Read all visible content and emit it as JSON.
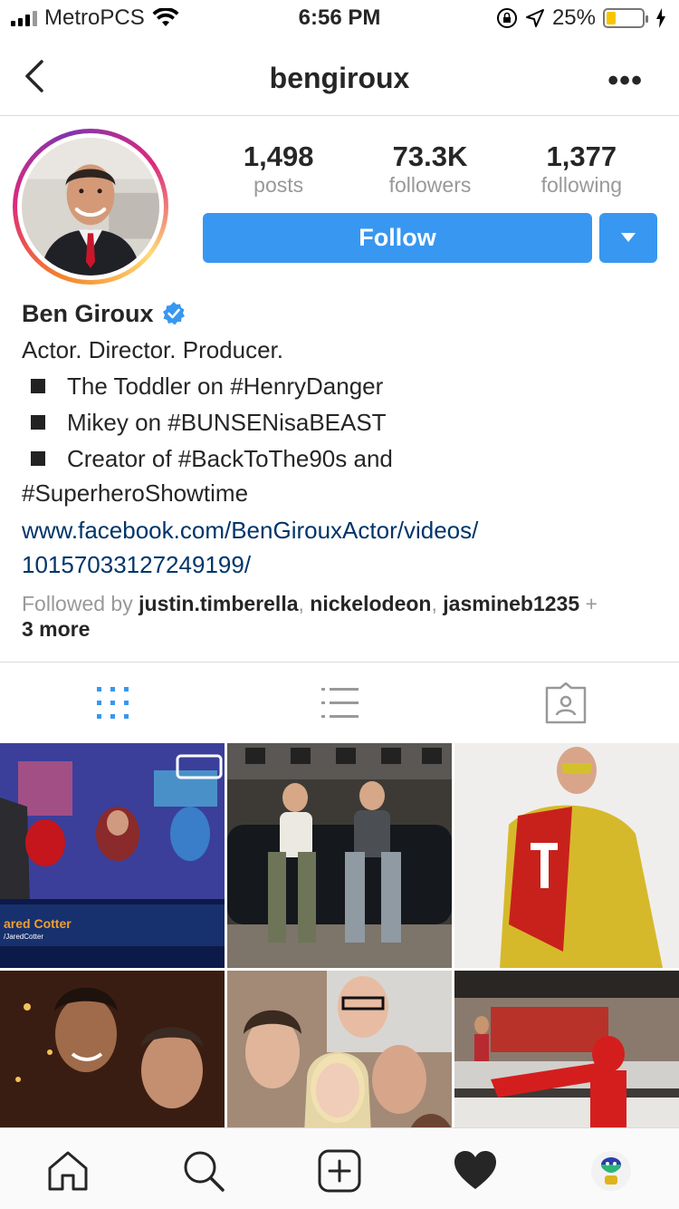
{
  "status_bar": {
    "carrier": "MetroPCS",
    "time": "6:56 PM",
    "battery_percent": "25%",
    "battery_level": 0.25,
    "icons": [
      "signal-icon",
      "wifi-icon",
      "rotation-lock-icon",
      "location-icon",
      "battery-icon",
      "charging-icon"
    ]
  },
  "nav": {
    "title": "bengiroux",
    "more": "•••"
  },
  "profile": {
    "stats": [
      {
        "value": "1,498",
        "label": "posts"
      },
      {
        "value": "73.3K",
        "label": "followers"
      },
      {
        "value": "1,377",
        "label": "following"
      }
    ],
    "follow_label": "Follow",
    "name": "Ben Giroux",
    "bio": {
      "line1": "Actor. Director. Producer.",
      "line2": "The Toddler on #HenryDanger",
      "line3": "Mikey on #BUNSENisaBEAST",
      "line4": "Creator of #BackToThe90s and",
      "line5": "#SuperheroShowtime"
    },
    "link_line1": "www.facebook.com/BenGirouxActor/videos/",
    "link_line2": "10157033127249199/",
    "followed_by_prefix": "Followed by",
    "followed_by_user1": "justin.timberella",
    "followed_by_user2": "nickelodeon",
    "followed_by_user3": "jasmineb1235",
    "followed_by_plus": "+",
    "followed_by_more": "3 more"
  },
  "posts": {
    "overlay_name": "ared Cotter",
    "overlay_handle": "/JaredCotter"
  },
  "colors": {
    "accent": "#3897f0",
    "link": "#003569",
    "verified": "#3897f0",
    "battery": "#f7c500"
  }
}
